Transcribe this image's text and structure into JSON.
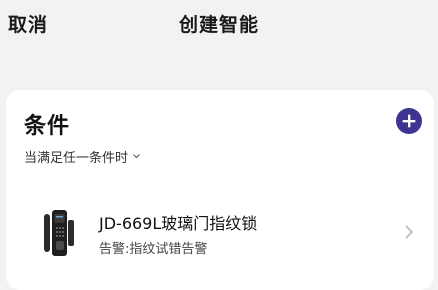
{
  "header": {
    "cancel_label": "取消",
    "title": "创建智能"
  },
  "condition_section": {
    "title": "条件",
    "trigger_mode": "当满足任一条件时",
    "add_icon": "plus-icon",
    "conditions": [
      {
        "device_name": "JD-669L玻璃门指纹锁",
        "status": "告警:指纹试错告警",
        "icon": "smart-lock-icon"
      }
    ]
  },
  "colors": {
    "accent": "#3d3591",
    "background": "#f2f2f4",
    "card": "#ffffff"
  }
}
